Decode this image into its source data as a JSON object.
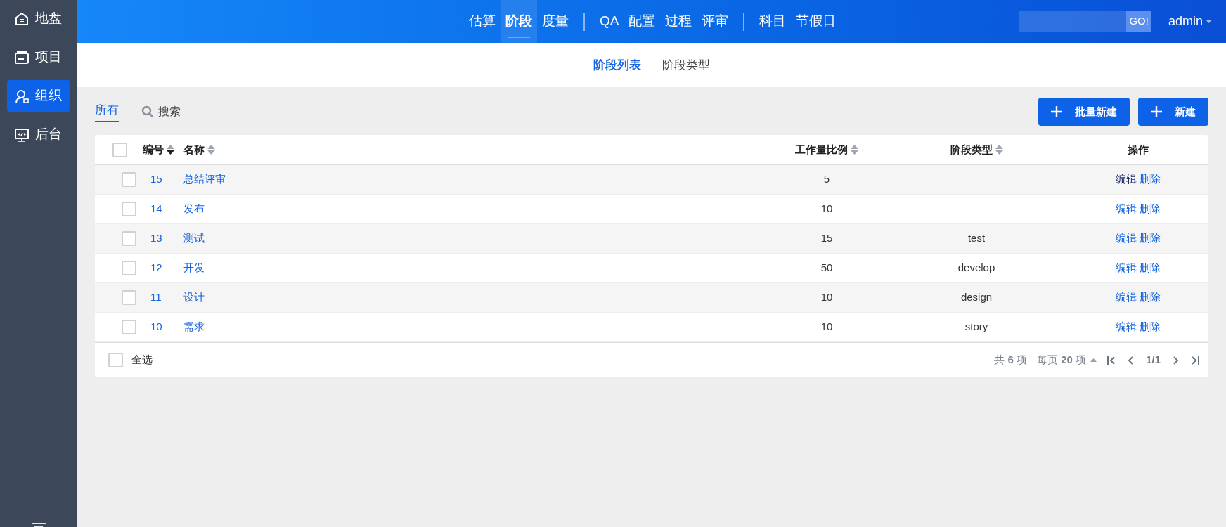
{
  "sidebar": {
    "items": [
      {
        "label": "地盘",
        "selected": false
      },
      {
        "label": "项目",
        "selected": false
      },
      {
        "label": "组织",
        "selected": true
      },
      {
        "label": "后台",
        "selected": false
      }
    ]
  },
  "topbar": {
    "nav_groups": [
      [
        {
          "label": "估算",
          "selected": false
        },
        {
          "label": "阶段",
          "selected": true
        },
        {
          "label": "度量",
          "selected": false
        }
      ],
      [
        {
          "label": "QA",
          "selected": false
        },
        {
          "label": "配置",
          "selected": false
        },
        {
          "label": "过程",
          "selected": false
        },
        {
          "label": "评审",
          "selected": false
        }
      ],
      [
        {
          "label": "科目",
          "selected": false
        },
        {
          "label": "节假日",
          "selected": false
        }
      ]
    ],
    "search_button": "GO!",
    "user": "admin"
  },
  "subnav": [
    {
      "label": "阶段列表",
      "selected": true
    },
    {
      "label": "阶段类型",
      "selected": false
    }
  ],
  "toolbar": {
    "filters": [
      {
        "label": "所有",
        "selected": true
      }
    ],
    "search": "搜索",
    "buttons": [
      "批量新建",
      "新建"
    ]
  },
  "table": {
    "columns": [
      {
        "label": "编号",
        "sortable": true,
        "sorted_descending": true
      },
      {
        "label": "名称",
        "sortable": true,
        "sorted_descending": false
      },
      {
        "label": "工作量比例",
        "sortable": true,
        "sorted_descending": false
      },
      {
        "label": "阶段类型",
        "sortable": true,
        "sorted_descending": false
      },
      {
        "label": "操作",
        "sortable": false
      }
    ],
    "rows": [
      {
        "checked": false,
        "id": "15",
        "name": "总结评审",
        "workload": "5",
        "type": "",
        "actions": [
          "编辑",
          "删除"
        ],
        "edit_hovered": true
      },
      {
        "checked": false,
        "id": "14",
        "name": "发布",
        "workload": "10",
        "type": "",
        "actions": [
          "编辑",
          "删除"
        ],
        "edit_hovered": false
      },
      {
        "checked": false,
        "id": "13",
        "name": "测试",
        "workload": "15",
        "type": "test",
        "actions": [
          "编辑",
          "删除"
        ],
        "edit_hovered": false
      },
      {
        "checked": false,
        "id": "12",
        "name": "开发",
        "workload": "50",
        "type": "develop",
        "actions": [
          "编辑",
          "删除"
        ],
        "edit_hovered": false
      },
      {
        "checked": false,
        "id": "11",
        "name": "设计",
        "workload": "10",
        "type": "design",
        "actions": [
          "编辑",
          "删除"
        ],
        "edit_hovered": false
      },
      {
        "checked": false,
        "id": "10",
        "name": "需求",
        "workload": "10",
        "type": "story",
        "actions": [
          "编辑",
          "删除"
        ],
        "edit_hovered": false
      }
    ],
    "footer": {
      "select_all": "全选",
      "select_all_checked": false,
      "total": "共 **6** 项",
      "per_page": "每页 **20** 项",
      "page": "1/1"
    }
  }
}
